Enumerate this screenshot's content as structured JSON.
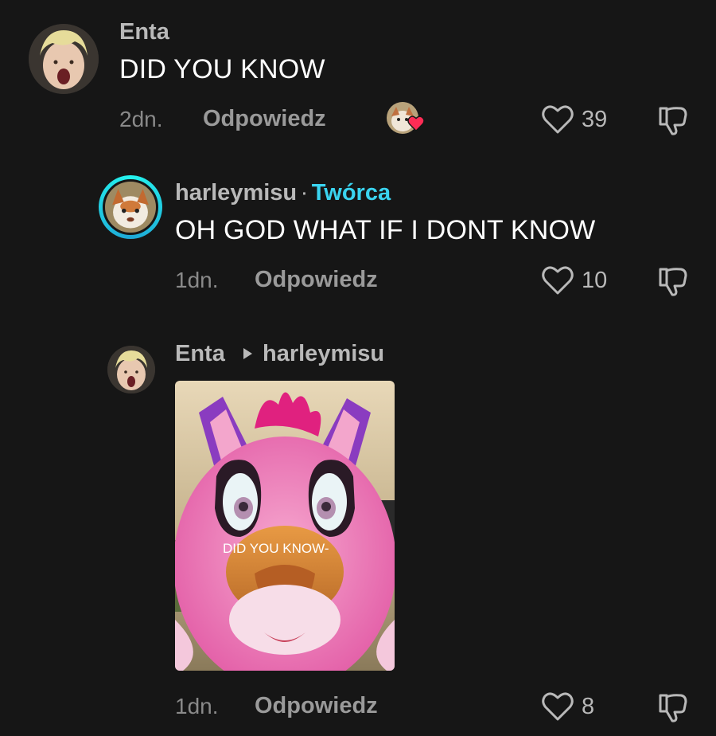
{
  "comments": [
    {
      "username": "Enta",
      "text": "DID YOU KNOW",
      "time": "2dn.",
      "reply_label": "Odpowiedz",
      "likes": "39"
    },
    {
      "username": "harleymisu",
      "separator": "·",
      "badge": "Twórca",
      "text": "OH GOD WHAT IF I DONT KNOW",
      "time": "1dn.",
      "reply_label": "Odpowiedz",
      "likes": "10"
    },
    {
      "username": "Enta",
      "reply_to": "harleymisu",
      "media_caption": "DID YOU KNOW-",
      "time": "1dn.",
      "reply_label": "Odpowiedz",
      "likes": "8"
    }
  ],
  "icons": {
    "like": "heart-outline-icon",
    "dislike": "thumbs-down-icon",
    "reply_arrow": "triangle-right-icon",
    "creator_liked": "creator-liked-avatar-heart-icon"
  },
  "colors": {
    "background": "#161616",
    "creator_badge": "#3ad4f0",
    "liked_heart": "#fe2c55"
  }
}
